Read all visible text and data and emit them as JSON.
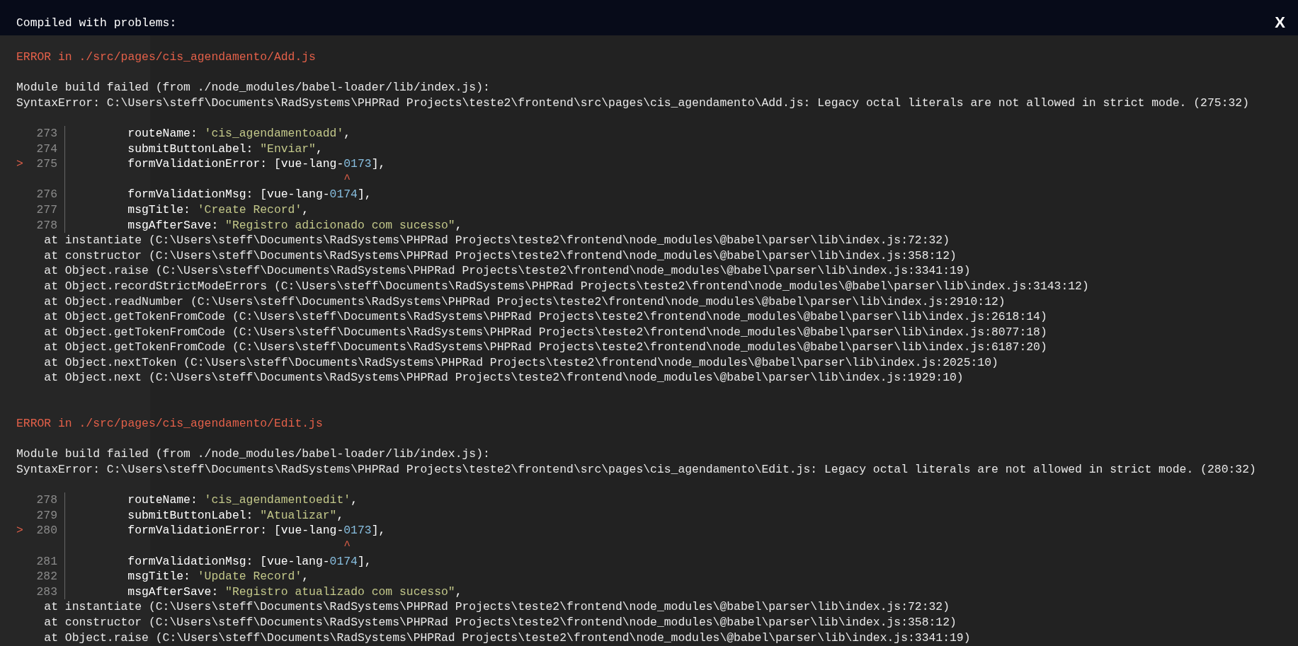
{
  "overlay": {
    "title": "Compiled with problems:",
    "close": "X",
    "errors": [
      {
        "heading": "ERROR in ./src/pages/cis_agendamento/Add.js",
        "message": [
          "Module build failed (from ./node_modules/babel-loader/lib/index.js):",
          "SyntaxError: C:\\Users\\steff\\Documents\\RadSystems\\PHPRad Projects\\teste2\\frontend\\src\\pages\\cis_agendamento\\Add.js: Legacy octal literals are not allowed in strict mode. (275:32)"
        ],
        "code": [
          {
            "kind": "code",
            "number": "273",
            "tokens": [
              {
                "kind": "plain",
                "text": "routeName: "
              },
              {
                "kind": "string",
                "text": "'cis_agendamentoadd'"
              },
              {
                "kind": "plain",
                "text": ","
              }
            ]
          },
          {
            "kind": "code",
            "number": "274",
            "tokens": [
              {
                "kind": "plain",
                "text": "submitButtonLabel: "
              },
              {
                "kind": "string",
                "text": "\"Enviar\""
              },
              {
                "kind": "plain",
                "text": ","
              }
            ]
          },
          {
            "kind": "code",
            "number": "275",
            "marker": ">",
            "tokens": [
              {
                "kind": "plain",
                "text": "formValidationError: [vue-lang-"
              },
              {
                "kind": "number",
                "text": "0173"
              },
              {
                "kind": "plain",
                "text": "],"
              }
            ]
          },
          {
            "kind": "caret",
            "text": "^"
          },
          {
            "kind": "code",
            "number": "276",
            "tokens": [
              {
                "kind": "plain",
                "text": "formValidationMsg: [vue-lang-"
              },
              {
                "kind": "number",
                "text": "0174"
              },
              {
                "kind": "plain",
                "text": "],"
              }
            ]
          },
          {
            "kind": "code",
            "number": "277",
            "tokens": [
              {
                "kind": "plain",
                "text": "msgTitle: "
              },
              {
                "kind": "string",
                "text": "'Create Record'"
              },
              {
                "kind": "plain",
                "text": ","
              }
            ]
          },
          {
            "kind": "code",
            "number": "278",
            "tokens": [
              {
                "kind": "plain",
                "text": "msgAfterSave: "
              },
              {
                "kind": "string",
                "text": "\"Registro adicionado com sucesso\""
              },
              {
                "kind": "plain",
                "text": ","
              }
            ]
          }
        ],
        "stack": [
          "at instantiate (C:\\Users\\steff\\Documents\\RadSystems\\PHPRad Projects\\teste2\\frontend\\node_modules\\@babel\\parser\\lib\\index.js:72:32)",
          "at constructor (C:\\Users\\steff\\Documents\\RadSystems\\PHPRad Projects\\teste2\\frontend\\node_modules\\@babel\\parser\\lib\\index.js:358:12)",
          "at Object.raise (C:\\Users\\steff\\Documents\\RadSystems\\PHPRad Projects\\teste2\\frontend\\node_modules\\@babel\\parser\\lib\\index.js:3341:19)",
          "at Object.recordStrictModeErrors (C:\\Users\\steff\\Documents\\RadSystems\\PHPRad Projects\\teste2\\frontend\\node_modules\\@babel\\parser\\lib\\index.js:3143:12)",
          "at Object.readNumber (C:\\Users\\steff\\Documents\\RadSystems\\PHPRad Projects\\teste2\\frontend\\node_modules\\@babel\\parser\\lib\\index.js:2910:12)",
          "at Object.getTokenFromCode (C:\\Users\\steff\\Documents\\RadSystems\\PHPRad Projects\\teste2\\frontend\\node_modules\\@babel\\parser\\lib\\index.js:2618:14)",
          "at Object.getTokenFromCode (C:\\Users\\steff\\Documents\\RadSystems\\PHPRad Projects\\teste2\\frontend\\node_modules\\@babel\\parser\\lib\\index.js:8077:18)",
          "at Object.getTokenFromCode (C:\\Users\\steff\\Documents\\RadSystems\\PHPRad Projects\\teste2\\frontend\\node_modules\\@babel\\parser\\lib\\index.js:6187:20)",
          "at Object.nextToken (C:\\Users\\steff\\Documents\\RadSystems\\PHPRad Projects\\teste2\\frontend\\node_modules\\@babel\\parser\\lib\\index.js:2025:10)",
          "at Object.next (C:\\Users\\steff\\Documents\\RadSystems\\PHPRad Projects\\teste2\\frontend\\node_modules\\@babel\\parser\\lib\\index.js:1929:10)"
        ]
      },
      {
        "heading": "ERROR in ./src/pages/cis_agendamento/Edit.js",
        "message": [
          "Module build failed (from ./node_modules/babel-loader/lib/index.js):",
          "SyntaxError: C:\\Users\\steff\\Documents\\RadSystems\\PHPRad Projects\\teste2\\frontend\\src\\pages\\cis_agendamento\\Edit.js: Legacy octal literals are not allowed in strict mode. (280:32)"
        ],
        "code": [
          {
            "kind": "code",
            "number": "278",
            "tokens": [
              {
                "kind": "plain",
                "text": "routeName: "
              },
              {
                "kind": "string",
                "text": "'cis_agendamentoedit'"
              },
              {
                "kind": "plain",
                "text": ","
              }
            ]
          },
          {
            "kind": "code",
            "number": "279",
            "tokens": [
              {
                "kind": "plain",
                "text": "submitButtonLabel: "
              },
              {
                "kind": "string",
                "text": "\"Atualizar\""
              },
              {
                "kind": "plain",
                "text": ","
              }
            ]
          },
          {
            "kind": "code",
            "number": "280",
            "marker": ">",
            "tokens": [
              {
                "kind": "plain",
                "text": "formValidationError: [vue-lang-"
              },
              {
                "kind": "number",
                "text": "0173"
              },
              {
                "kind": "plain",
                "text": "],"
              }
            ]
          },
          {
            "kind": "caret",
            "text": "^"
          },
          {
            "kind": "code",
            "number": "281",
            "tokens": [
              {
                "kind": "plain",
                "text": "formValidationMsg: [vue-lang-"
              },
              {
                "kind": "number",
                "text": "0174"
              },
              {
                "kind": "plain",
                "text": "],"
              }
            ]
          },
          {
            "kind": "code",
            "number": "282",
            "tokens": [
              {
                "kind": "plain",
                "text": "msgTitle: "
              },
              {
                "kind": "string",
                "text": "'Update Record'"
              },
              {
                "kind": "plain",
                "text": ","
              }
            ]
          },
          {
            "kind": "code",
            "number": "283",
            "tokens": [
              {
                "kind": "plain",
                "text": "msgAfterSave: "
              },
              {
                "kind": "string",
                "text": "\"Registro atualizado com sucesso\""
              },
              {
                "kind": "plain",
                "text": ","
              }
            ]
          }
        ],
        "stack": [
          "at instantiate (C:\\Users\\steff\\Documents\\RadSystems\\PHPRad Projects\\teste2\\frontend\\node_modules\\@babel\\parser\\lib\\index.js:72:32)",
          "at constructor (C:\\Users\\steff\\Documents\\RadSystems\\PHPRad Projects\\teste2\\frontend\\node_modules\\@babel\\parser\\lib\\index.js:358:12)",
          "at Object.raise (C:\\Users\\steff\\Documents\\RadSystems\\PHPRad Projects\\teste2\\frontend\\node_modules\\@babel\\parser\\lib\\index.js:3341:19)"
        ]
      }
    ]
  }
}
